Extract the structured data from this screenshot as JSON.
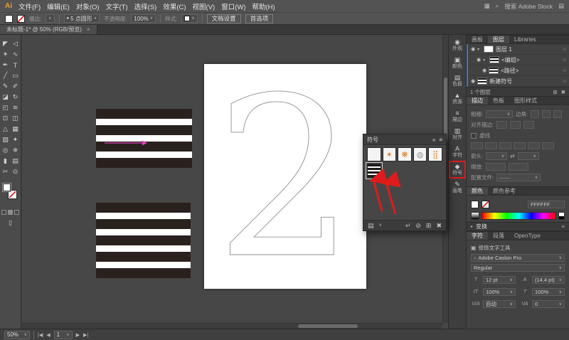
{
  "colors": {
    "menubar_bg": "#535353",
    "canvas_bg": "#474747",
    "stripe": "#29211e",
    "arrow_pink": "#e040c0",
    "annotation_red": "#e01b1b",
    "symbol_orange": "#e07a1f",
    "numeral_stroke": "#8f8f8f",
    "selection_blue": "#3b78c4"
  },
  "menubar": {
    "logo": "Ai",
    "menus": [
      "文件(F)",
      "编辑(E)",
      "对象(O)",
      "文字(T)",
      "选择(S)",
      "效果(C)",
      "视图(V)",
      "窗口(W)",
      "帮助(H)"
    ],
    "workspace_icon": "▦",
    "search_icon": "⌕",
    "search_text": "搜索 Adobe Stock",
    "grid_icon": "▤"
  },
  "control_bar": {
    "stroke_label": "描边:",
    "brush_dot": "●",
    "brush_name": "5 点圆形",
    "opacity_label": "不透明度:",
    "opacity_value": "100%",
    "style_label": "样式:",
    "doc_setup": "文档设置",
    "preferences": "首选项",
    "caret": "∨"
  },
  "doc_tab": {
    "title": "未标题-1* @ 50% (RGB/预览)",
    "close": "×"
  },
  "tools": {
    "glyphs": [
      "◤",
      "◁",
      "✶",
      "∿",
      "✒",
      "T",
      "╱",
      "▭",
      "✎",
      "✐",
      "◪",
      "↻",
      "◰",
      "≋",
      "⊡",
      "◫",
      "△",
      "▦",
      "▧",
      "✦",
      "◎",
      "✵",
      "▮",
      "▤",
      "✂",
      "⊙"
    ]
  },
  "artboard": {
    "numeral": "2"
  },
  "symbols_panel": {
    "title": "符号",
    "collapse_icon": "«",
    "menu_icon": "≡",
    "thumb_glyphs": [
      "",
      "✶",
      "❋",
      "◍",
      "⣿"
    ],
    "library_icon": "▤",
    "caret": "∨",
    "place_icon": "↵",
    "break_icon": "⊘",
    "new_icon": "⊞",
    "delete_icon": "✖"
  },
  "icon_strip": {
    "items": [
      {
        "label": "外观",
        "glyph": "◉"
      },
      {
        "label": "颜色",
        "glyph": "▣"
      },
      {
        "label": "色板",
        "glyph": "▤"
      },
      {
        "label": "资源",
        "glyph": "▲"
      },
      {
        "label": "描边",
        "glyph": "≡"
      },
      {
        "label": "对齐",
        "glyph": "▥"
      },
      {
        "label": "字符",
        "glyph": "A"
      },
      {
        "label": "符号",
        "glyph": "◆"
      },
      {
        "label": "画笔",
        "glyph": "✎"
      }
    ]
  },
  "layers_panel": {
    "tabs": [
      "画板",
      "图层",
      "Libraries"
    ],
    "eye_icon": "◉",
    "target_icon": "○",
    "rows": [
      {
        "expander": "▾",
        "name": "图层 1"
      },
      {
        "expander": "▾",
        "name": "<编组>"
      },
      {
        "expander": "",
        "name": "<路径>"
      },
      {
        "expander": "",
        "name": "新建符号"
      }
    ],
    "footer_text": "1 个图层",
    "new_icon": "⊞",
    "delete_icon": "✖"
  },
  "stroke_panel": {
    "tabs": [
      "描边",
      "色板",
      "图形样式"
    ],
    "weight_label": "粗细:",
    "corner_label": "边角:",
    "align_label": "对齐描边:",
    "dash_label": "虚线",
    "arrow_label": "箭头:",
    "swap_icon": "⇄",
    "scale_label": "缩放:",
    "profile_label": "配置文件:",
    "profile_value": "——",
    "caret": "∨"
  },
  "color_panel": {
    "tabs": [
      "颜色",
      "颜色参考"
    ],
    "hex_value": "FFFFFF"
  },
  "transform_panel": {
    "title": "变换",
    "icon": "▸",
    "menu_icon": "≡"
  },
  "character_panel": {
    "tabs": [
      "字符",
      "段落",
      "OpenType"
    ],
    "touch_icon": "▣",
    "touch_label": "修饰文字工具",
    "search_icon": "⌕",
    "font_name": "Adobe Caslon Pro",
    "style_name": "Regular",
    "caret": "∨",
    "rows": [
      {
        "icon": "T",
        "value": "12 pt"
      },
      {
        "icon": "A",
        "value": "(14.4 pt)"
      },
      {
        "icon": "IT",
        "value": "100%"
      },
      {
        "icon": "T",
        "value": "100%"
      },
      {
        "icon": "V/A",
        "value": "自动"
      },
      {
        "icon": "VA",
        "value": "0"
      }
    ]
  },
  "status_bar": {
    "zoom": "50%",
    "caret": "∨",
    "first_icon": "|◀",
    "prev_icon": "◀",
    "artboard": "1",
    "next_icon": "▶",
    "last_icon": "▶|"
  }
}
